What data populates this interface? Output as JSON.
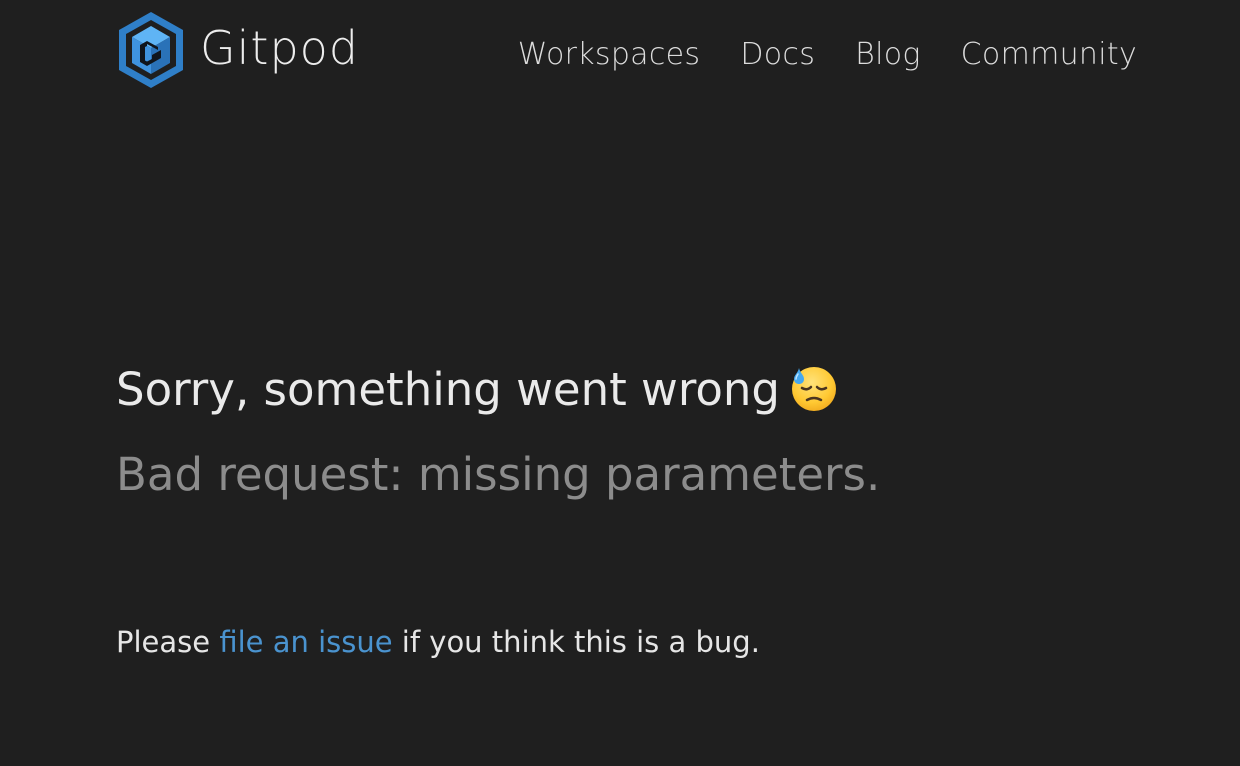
{
  "header": {
    "brand_name": "Gitpod",
    "nav": [
      {
        "label": "Workspaces"
      },
      {
        "label": "Docs"
      },
      {
        "label": "Blog"
      },
      {
        "label": "Community"
      }
    ]
  },
  "main": {
    "title": "Sorry, something went wrong",
    "title_icon": "downcast-face-with-sweat-icon",
    "message": "Bad request: missing parameters.",
    "help_prefix": "Please ",
    "help_link": "file an issue",
    "help_suffix": " if you think this is a bug."
  },
  "colors": {
    "background": "#1f1f1f",
    "link": "#4a93cf",
    "logo": "#3b8ad9",
    "muted_text": "#8c8c8c"
  }
}
